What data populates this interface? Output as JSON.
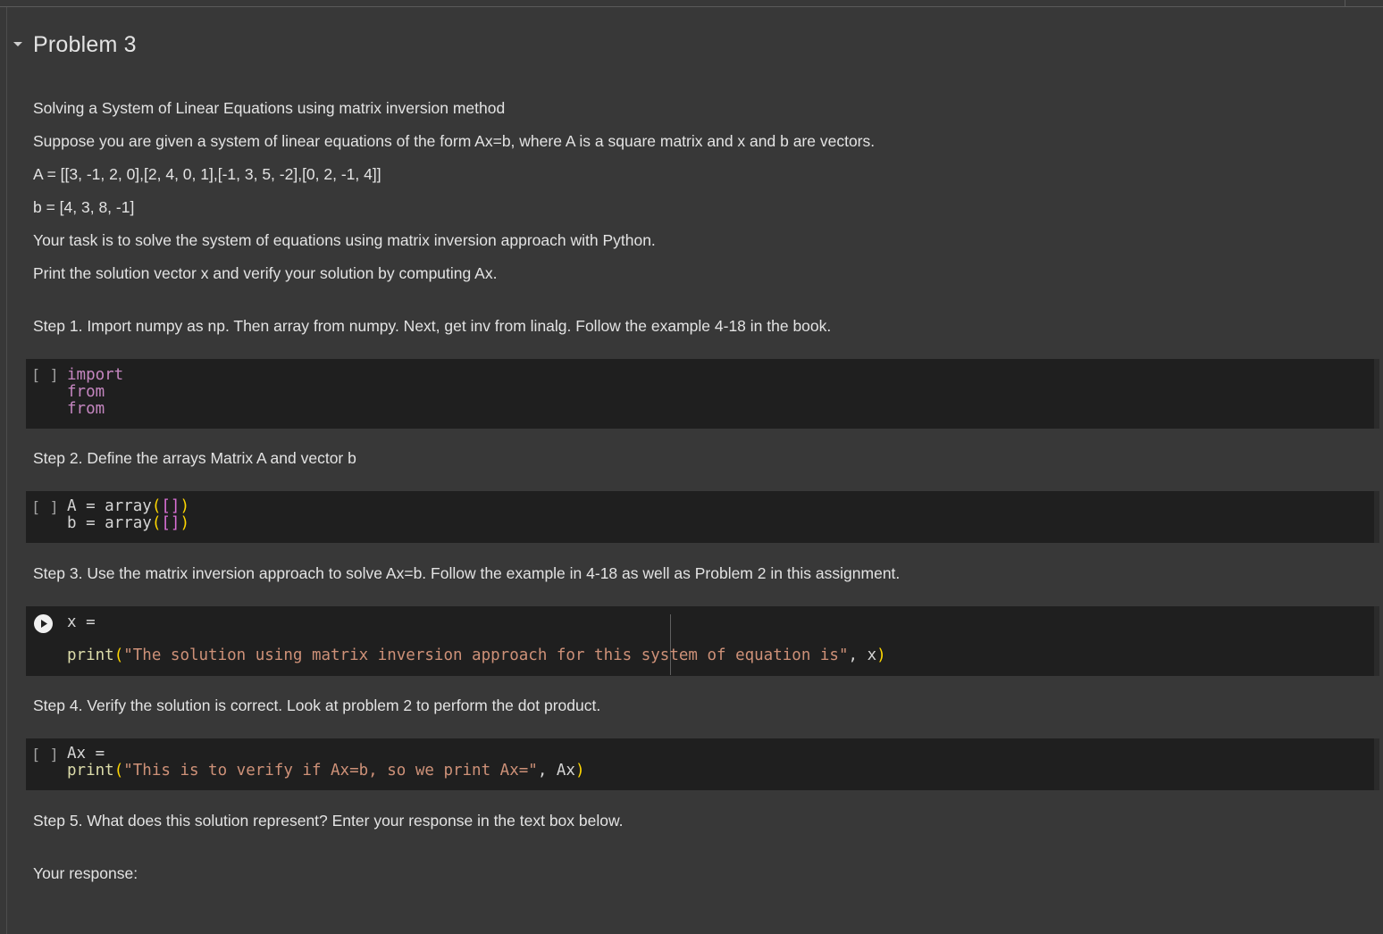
{
  "section": {
    "title": "Problem 3"
  },
  "intro": {
    "heading": "Solving a System of Linear Equations using matrix inversion method",
    "description": "Suppose you are given a system of linear equations of the form Ax=b, where A is a square matrix and x and b are vectors.",
    "matrix_a": "A = [[3, -1, 2, 0],[2, 4, 0, 1],[-1, 3, 5, -2],[0, 2, -1, 4]]",
    "vector_b": "b = [4, 3, 8, -1]",
    "task": "Your task is to solve the system of equations using matrix inversion approach with Python.",
    "print_instruction": "Print the solution vector x and verify your solution by computing Ax."
  },
  "steps": {
    "step1": "Step 1. Import numpy as np. Then array from numpy. Next, get inv from linalg. Follow the example 4-18 in the book.",
    "step2": "Step 2. Define the arrays Matrix A and vector b",
    "step3": "Step 3. Use the matrix inversion approach to solve Ax=b. Follow the example in 4-18 as well as Problem 2 in this assignment.",
    "step4": "Step 4. Verify the solution is correct. Look at problem 2 to perform the dot product.",
    "step5": "Step 5. What does this solution represent? Enter your response in the text box below.",
    "response_label": "Your response:"
  },
  "cells": {
    "run_bracket": "[ ]",
    "cell1": {
      "line1": "import",
      "line2": "from",
      "line3": "from"
    },
    "cell2": {
      "line1_prefix": "A = ",
      "line1_fn": "array",
      "line1_open": "(",
      "line1_list": "[]",
      "line1_close": ")",
      "line2_prefix": "b = ",
      "line2_fn": "array",
      "line2_open": "(",
      "line2_list": "[]",
      "line2_close": ")"
    },
    "cell3": {
      "line1": "x =",
      "print_fn": "print",
      "open": "(",
      "string": "\"The solution using matrix inversion approach for this system of equation is\"",
      "rest": ", x",
      "close": ")"
    },
    "cell4": {
      "line1": "Ax =",
      "print_fn": "print",
      "open": "(",
      "string": "\"This is to verify if Ax=b, so we print Ax=\"",
      "rest": ", Ax",
      "close": ")"
    }
  },
  "icons": {
    "collapse": "caret-down-icon",
    "run": "play-icon"
  }
}
